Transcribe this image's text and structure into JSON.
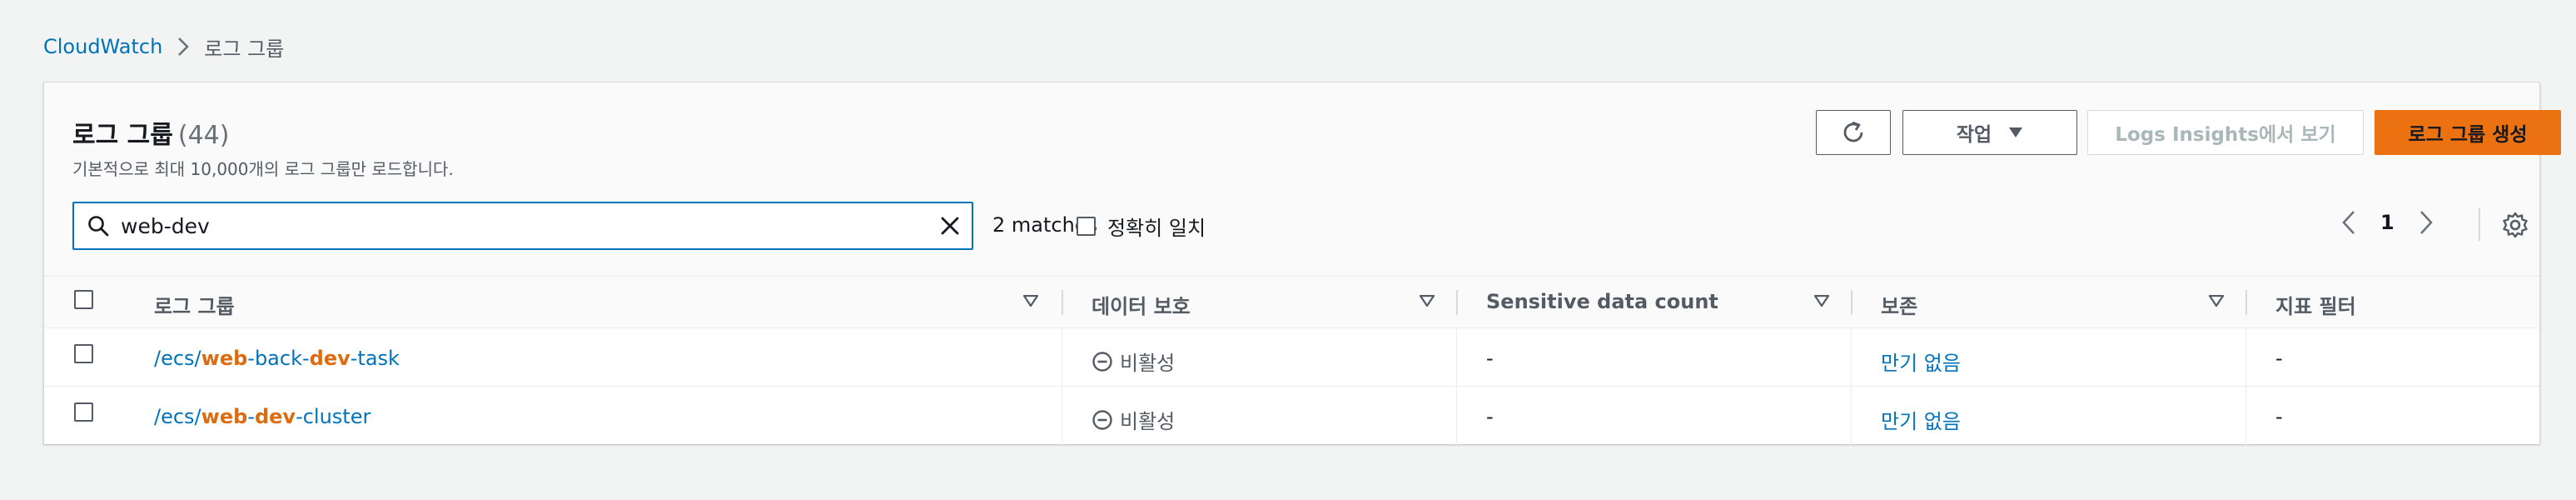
{
  "breadcrumb": {
    "root": "CloudWatch",
    "current": "로그 그룹"
  },
  "header": {
    "title": "로그 그룹",
    "count": "(44)",
    "description": "기본적으로 최대 10,000개의 로그 그룹만 로드합니다."
  },
  "actions": {
    "actions_label": "작업",
    "insights_label": "Logs Insights에서 보기",
    "create_label": "로그 그룹 생성"
  },
  "search": {
    "value": "web-dev",
    "placeholder": ""
  },
  "filter": {
    "matches": "2 matches",
    "exact_label": "정확히 일치"
  },
  "pagination": {
    "page": "1"
  },
  "table": {
    "columns": {
      "name": "로그 그룹",
      "protection": "데이터 보호",
      "sensitive": "Sensitive data count",
      "retention": "보존",
      "filters": "지표 필터"
    },
    "rows": [
      {
        "name_prefix": "/ecs/",
        "name_parts": [
          "web",
          "-back-",
          "dev",
          "-task"
        ],
        "protection": "비활성",
        "sensitive": "-",
        "retention": "만기 없음",
        "filters": "-"
      },
      {
        "name_prefix": "/ecs/",
        "name_parts": [
          "web",
          "-",
          "dev",
          "-cluster"
        ],
        "protection": "비활성",
        "sensitive": "-",
        "retention": "만기 없음",
        "filters": "-"
      }
    ]
  },
  "colors": {
    "accent": "#0073bb",
    "primary_button": "#ec7211",
    "highlight": "#dd6b10"
  }
}
